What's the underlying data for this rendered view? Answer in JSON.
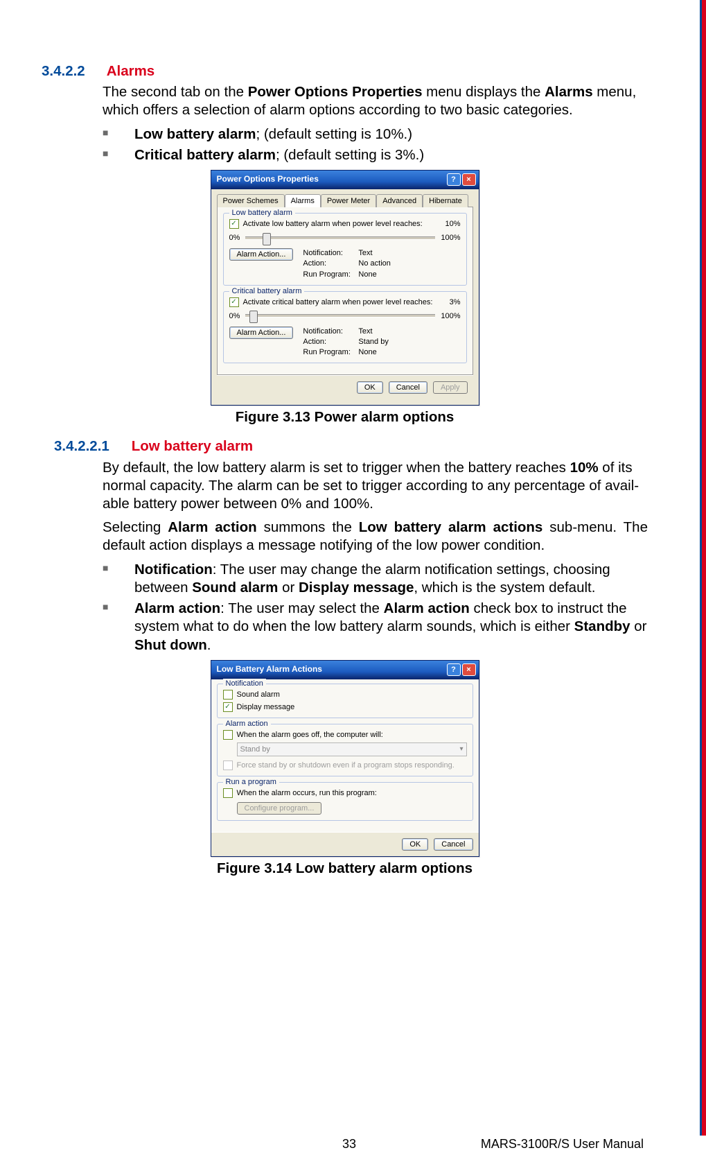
{
  "section1": {
    "number": "3.4.2.2",
    "title": "Alarms",
    "para": "The second tab on the ",
    "para_bold1": "Power Options Properties",
    "para_mid": " menu displays the ",
    "para_bold2": "Alarms",
    "para_end": " menu, which offers a selection of alarm options according to two basic categories.",
    "bullet1_b": "Low battery alarm",
    "bullet1_r": "; (default setting is 10%.)",
    "bullet2_b": "Critical battery alarm",
    "bullet2_r": "; (default setting is 3%.)"
  },
  "dlg1": {
    "title": "Power Options Properties",
    "tabs": [
      "Power Schemes",
      "Alarms",
      "Power Meter",
      "Advanced",
      "Hibernate"
    ],
    "low": {
      "legend": "Low battery alarm",
      "chk": "Activate low battery alarm when power level reaches:",
      "pct": "10%",
      "left": "0%",
      "right": "100%",
      "thumb_pct": 10,
      "btn": "Alarm Action...",
      "k1": "Notification:",
      "v1": "Text",
      "k2": "Action:",
      "v2": "No action",
      "k3": "Run Program:",
      "v3": "None"
    },
    "crit": {
      "legend": "Critical battery alarm",
      "chk": "Activate critical battery alarm when power level reaches:",
      "pct": "3%",
      "left": "0%",
      "right": "100%",
      "thumb_pct": 3,
      "btn": "Alarm Action...",
      "k1": "Notification:",
      "v1": "Text",
      "k2": "Action:",
      "v2": "Stand by",
      "k3": "Run Program:",
      "v3": "None"
    },
    "ok": "OK",
    "cancel": "Cancel",
    "apply": "Apply"
  },
  "fig1": "Figure 3.13 Power alarm options",
  "section2": {
    "number": "3.4.2.2.1",
    "title": "Low battery alarm",
    "p1a": "By default, the low battery alarm is set to trigger when the battery reaches ",
    "p1b": "10%",
    "p1c": " of its normal capacity. The alarm can be set to trigger according to any percentage of avail-able battery power between 0% and 100%.",
    "p2a": "Selecting ",
    "p2b": "Alarm action",
    "p2c": " summons the ",
    "p2d": "Low battery alarm actions",
    "p2e": " sub-menu. The default action displays a message notifying of the low power condition.",
    "b1_b": "Notification",
    "b1_r": ": The user may change the alarm notification settings, choosing between ",
    "b1_b2": "Sound alarm",
    "b1_r2": " or ",
    "b1_b3": "Display message",
    "b1_r3": ", which is the system default.",
    "b2_b": "Alarm action",
    "b2_r": ": The user may select the ",
    "b2_b2": "Alarm action",
    "b2_r2": " check box to instruct the system what to do when the low battery alarm sounds, which is either ",
    "b2_b3": "Standby",
    "b2_r3": " or ",
    "b2_b4": "Shut down",
    "b2_r4": "."
  },
  "dlg2": {
    "title": "Low Battery Alarm Actions",
    "g1": "Notification",
    "c1": "Sound alarm",
    "c2": "Display message",
    "g2": "Alarm action",
    "c3": "When the alarm goes off, the computer will:",
    "dd": "Stand by",
    "c4": "Force stand by or shutdown even if a program stops responding.",
    "g3": "Run a program",
    "c5": "When the alarm occurs, run this program:",
    "btn": "Configure program...",
    "ok": "OK",
    "cancel": "Cancel"
  },
  "fig2": "Figure 3.14 Low battery alarm options",
  "footer": {
    "page": "33",
    "manual": "MARS-3100R/S User Manual"
  }
}
